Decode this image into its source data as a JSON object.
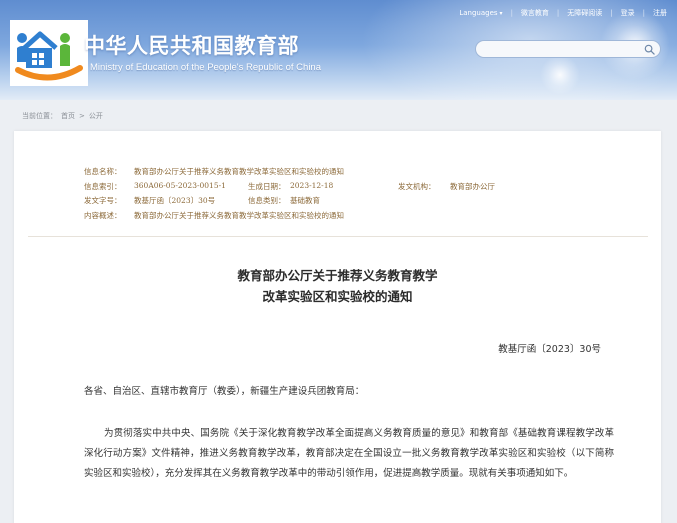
{
  "header": {
    "top_links": {
      "language": "Languages",
      "weibo": "微言教育",
      "accessible": "无障碍阅读",
      "login": "登录",
      "register": "注册",
      "separator": "|"
    },
    "title": "中华人民共和国教育部",
    "subtitle": "Ministry of Education of the People's Republic of China",
    "search_placeholder": ""
  },
  "breadcrumb": {
    "current": "当前位置：",
    "home": "首页",
    "separator": ">",
    "section": "公开"
  },
  "meta": {
    "info_name_label": "信息名称：",
    "info_name": "教育部办公厅关于推荐义务教育教学改革实验区和实验校的通知",
    "index_label": "信息索引：",
    "index": "360A06-05-2023-0015-1",
    "date_label": "生成日期：",
    "date": "2023-12-18",
    "issuer_label": "发文机构：",
    "issuer": "教育部办公厅",
    "doc_no_label": "发文字号：",
    "doc_no": "教基厅函〔2023〕30号",
    "category_label": "信息类别：",
    "category": "基础教育",
    "summary_label": "内容概述：",
    "summary": "教育部办公厅关于推荐义务教育教学改革实验区和实验校的通知"
  },
  "document": {
    "title_line1": "教育部办公厅关于推荐义务教育教学",
    "title_line2": "改革实验区和实验校的通知",
    "number": "教基厅函〔2023〕30号",
    "salutation": "各省、自治区、直辖市教育厅（教委），新疆生产建设兵团教育局：",
    "paragraph1": "为贯彻落实中共中央、国务院《关于深化教育教学改革全面提高义务教育质量的意见》和教育部《基础教育课程教学改革深化行动方案》文件精神，推进义务教育教学改革，教育部决定在全国设立一批义务教育教学改革实验区和实验校（以下简称实验区和实验校），充分发挥其在义务教育教学改革中的带动引领作用，促进提高教学质量。现就有关事项通知如下。"
  },
  "colors": {
    "header_blue": "#6f9ad6",
    "meta_text": "#8c6a3a",
    "logo_orange": "#f08a1e",
    "logo_blue": "#2f7fd0",
    "logo_green": "#5bb63a"
  }
}
